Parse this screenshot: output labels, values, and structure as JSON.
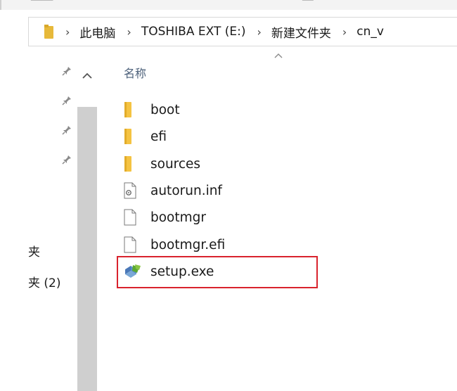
{
  "address_bar": {
    "breadcrumbs": [
      "此电脑",
      "TOSHIBA EXT (E:)",
      "新建文件夹",
      "cn_v"
    ]
  },
  "nav": {
    "partial_items": [
      "夹",
      "夹 (2)"
    ]
  },
  "file_list": {
    "column_header": "名称",
    "files": [
      {
        "name": "boot",
        "icon": "folder-icon"
      },
      {
        "name": "efi",
        "icon": "folder-icon"
      },
      {
        "name": "sources",
        "icon": "folder-icon"
      },
      {
        "name": "autorun.inf",
        "icon": "settings-file-icon"
      },
      {
        "name": "bootmgr",
        "icon": "file-icon"
      },
      {
        "name": "bootmgr.efi",
        "icon": "file-icon"
      },
      {
        "name": "setup.exe",
        "icon": "setup-exe-icon"
      }
    ]
  },
  "colors": {
    "highlight": "#d9232d",
    "folder": "#f5c342",
    "header_text": "#4c607a"
  }
}
